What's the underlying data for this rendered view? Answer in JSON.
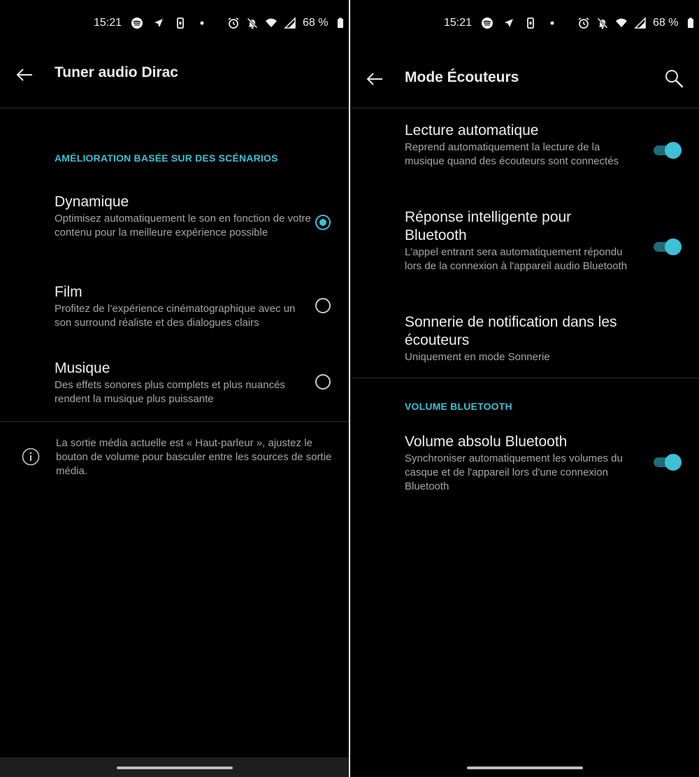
{
  "status_bar": {
    "time": "15:21",
    "battery": "68 %",
    "left_icons": [
      "spotify-icon",
      "navigation-icon",
      "phone-screen-icon",
      "dot-icon"
    ],
    "right_icons": [
      "alarm-icon",
      "notifications-off-icon",
      "wifi-icon",
      "signal-icon",
      "battery-icon"
    ]
  },
  "left": {
    "title": "Tuner audio Dirac",
    "section_header": "AMÉLIORATION BASÉE SUR DES SCÉNARIOS",
    "options": [
      {
        "title": "Dynamique",
        "desc": "Optimisez automatiquement le son en fonction de votre contenu pour la meilleure expérience possible",
        "selected": true
      },
      {
        "title": "Film",
        "desc": "Profitez de l’expérience cinématographique avec un son surround réaliste et des dialogues clairs",
        "selected": false
      },
      {
        "title": "Musique",
        "desc": "Des effets sonores plus complets et plus nuancés rendent la musique plus puissante",
        "selected": false
      }
    ],
    "info_text": "La sortie média actuelle est « Haut-parleur », ajustez le bouton de volume pour basculer entre les sources de sortie média."
  },
  "right": {
    "title": "Mode Écouteurs",
    "items": [
      {
        "title": "Lecture automatique",
        "desc": "Reprend automatiquement la lecture de la musique quand des écouteurs sont connectés",
        "toggle": true
      },
      {
        "title": "Réponse intelligente pour Bluetooth",
        "desc": "L'appel entrant sera automatiquement répondu lors de la connexion à l'appareil audio Bluetooth",
        "toggle": true
      },
      {
        "title": "Sonnerie de notification dans les écouteurs",
        "desc": "Uniquement en mode Sonnerie"
      }
    ],
    "section_header": "VOLUME BLUETOOTH",
    "bt_item": {
      "title": "Volume absolu Bluetooth",
      "desc": "Synchroniser automatiquement les volumes du casque et de l'appareil lors d'une connexion Bluetooth",
      "toggle": true
    }
  },
  "colors": {
    "accent": "#3ec0d6",
    "background": "#000000"
  }
}
